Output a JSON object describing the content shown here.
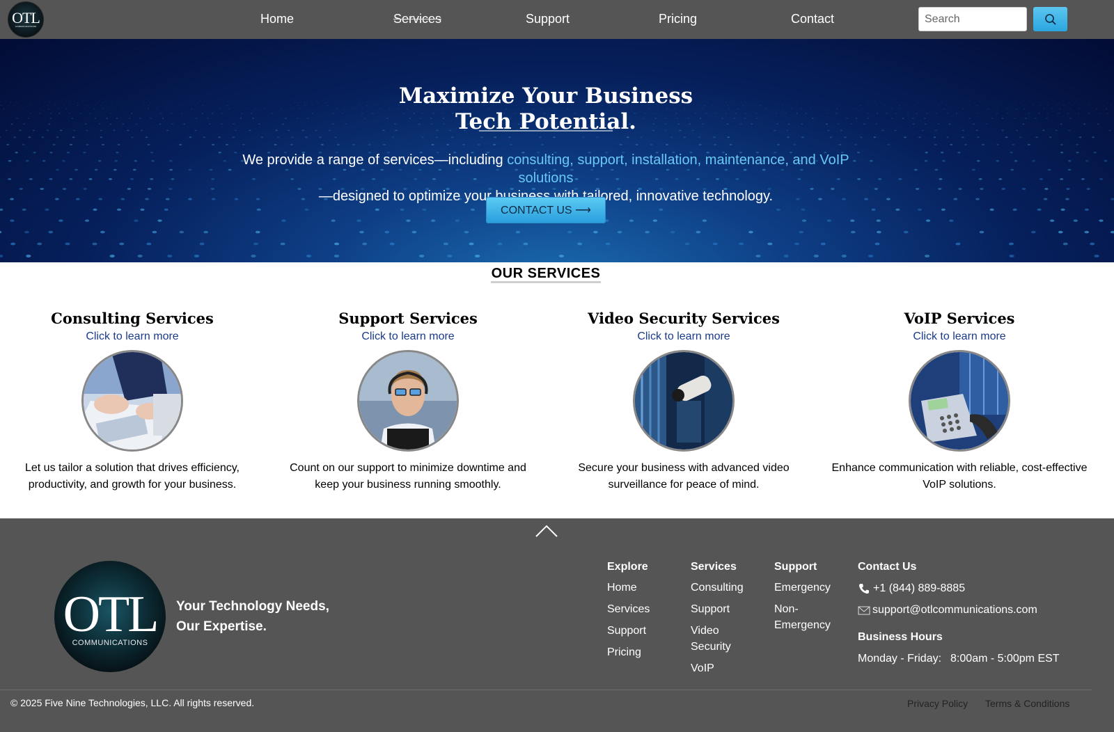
{
  "nav": {
    "logo_text": "OTL",
    "logo_subtext": "COMMUNICATIONS",
    "links": [
      "Home",
      "Services",
      "Support",
      "Pricing",
      "Contact"
    ],
    "search_placeholder": "Search",
    "search_icon": "search-icon"
  },
  "hero": {
    "title_line1": "Maximize Your Business",
    "title_line2": "Tech Potential.",
    "desc_part1": "We provide a range of services—including ",
    "desc_highlight": "consulting, support, installation, maintenance, and VoIP solutions",
    "desc_part2": "—designed to optimize your business with tailored, innovative technology.",
    "cta_label": "CONTACT US ⟶"
  },
  "services": {
    "heading": "OUR SERVICES",
    "items": [
      {
        "title": "Consulting Services",
        "link": "Click to learn more",
        "desc": "Let us tailor a solution that drives efficiency, productivity, and growth for your business."
      },
      {
        "title": "Support Services",
        "link": "Click to learn more",
        "desc": "Count on our support to minimize downtime and keep your business running smoothly."
      },
      {
        "title": "Video Security Services",
        "link": "Click to learn more",
        "desc": "Secure your business with advanced video surveillance for peace of mind."
      },
      {
        "title": "VoIP Services",
        "link": "Click to learn more",
        "desc": "Enhance communication with reliable, cost-effective VoIP solutions."
      }
    ]
  },
  "footer": {
    "logo_text": "OTL",
    "logo_subtext": "COMMUNICATIONS",
    "tagline_line1": "Your Technology Needs,",
    "tagline_line2": "Our Expertise.",
    "explore": {
      "title": "Explore",
      "items": [
        "Home",
        "Services",
        "Support",
        "Pricing"
      ]
    },
    "services": {
      "title": "Services",
      "items": [
        "Consulting",
        "Support",
        "Video Security",
        "VoIP"
      ]
    },
    "support": {
      "title": "Support",
      "items": [
        "Emergency",
        "Non-Emergency"
      ]
    },
    "contact": {
      "title": "Contact Us",
      "phone": "+1 (844) 889-8885",
      "email": "support@otlcommunications.com",
      "hours_title": "Business Hours",
      "hours_days": "Monday - Friday:",
      "hours_time": "8:00am - 5:00pm EST"
    },
    "copyright": "© 2025 Five Nine Technologies, LLC. All rights reserved.",
    "privacy": "Privacy Policy",
    "terms": "Terms & Conditions"
  },
  "colors": {
    "nav_bg": "#555555",
    "accent": "#2ba6e0",
    "hero_highlight": "#6ac8f5",
    "link": "#1a3a8a"
  }
}
